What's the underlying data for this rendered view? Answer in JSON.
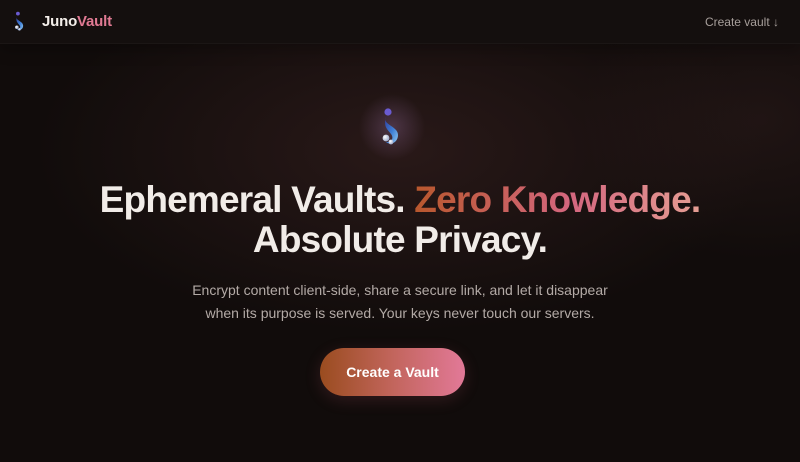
{
  "brand": {
    "name_part1": "Juno",
    "name_part2": "Vault",
    "logo_icon": "juno-vault-logo-icon"
  },
  "nav": {
    "create_vault_link": "Create vault ↓"
  },
  "hero": {
    "logo_icon": "juno-vault-logo-icon",
    "headline_plain_1": "Ephemeral Vaults.",
    "headline_gradient": "Zero Knowledge.",
    "headline_plain_2": "Absolute Privacy.",
    "subtitle_line1": "Encrypt content client-side, share a secure link, and let it disappear",
    "subtitle_line2": "when its purpose is served. Your keys never touch our servers.",
    "cta_label": "Create a Vault"
  },
  "colors": {
    "background": "#110c0b",
    "brand_accent": "#e07a93",
    "gradient_start": "#b8572d",
    "gradient_end": "#e27998",
    "muted_text": "#b3aaa6"
  }
}
